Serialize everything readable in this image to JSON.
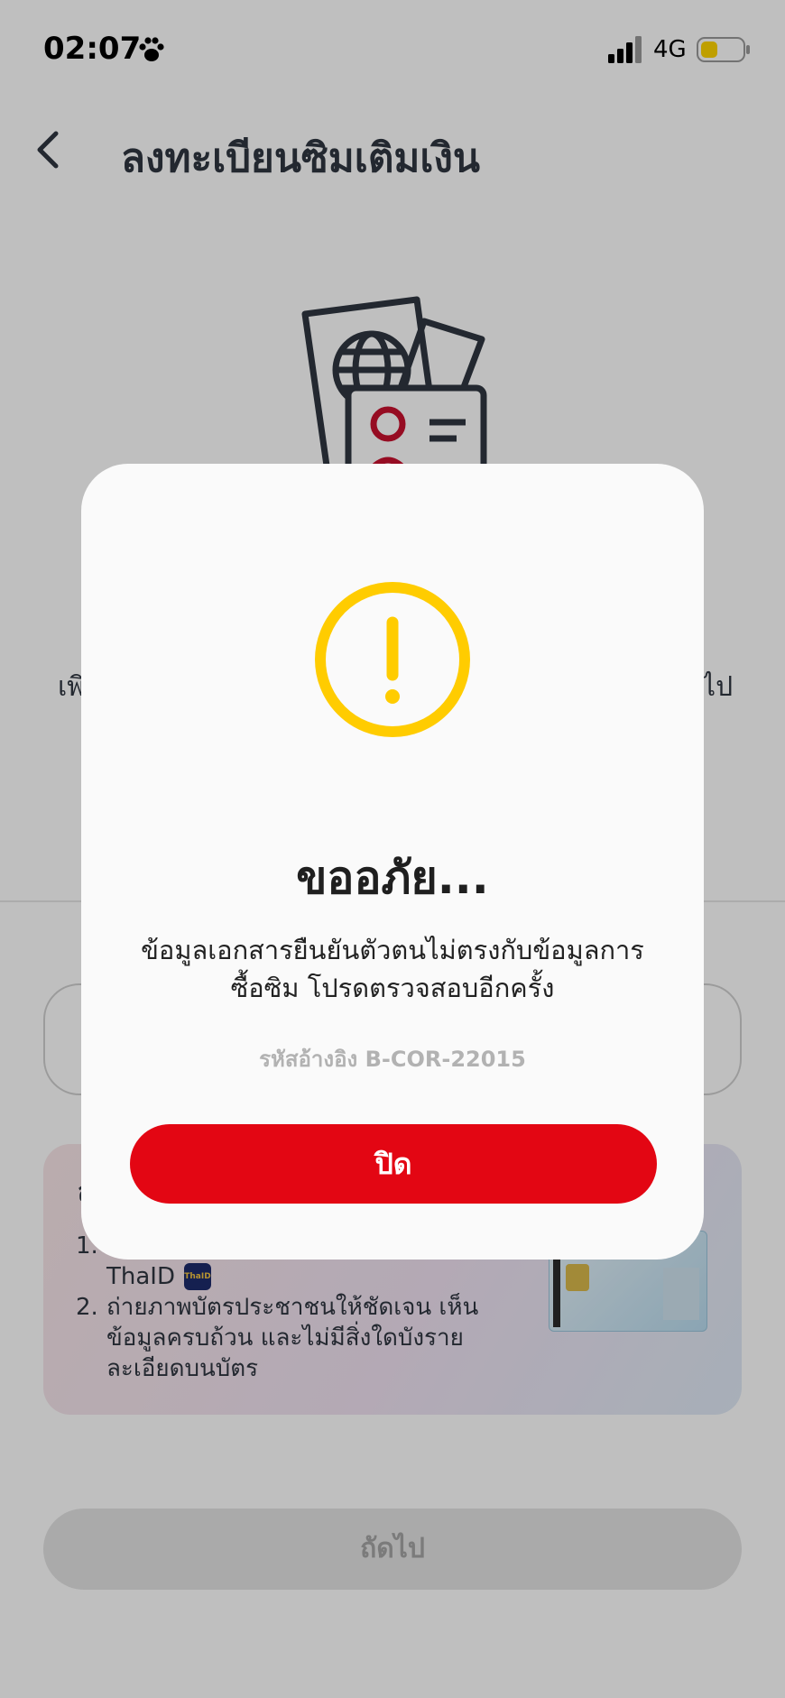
{
  "status_bar": {
    "time": "02:07",
    "network": "4G",
    "paw_icon": "paw-icon",
    "signal_icon": "signal-icon",
    "battery_icon": "battery-icon",
    "battery_color": "#ffd400"
  },
  "header": {
    "title": "ลงทะเบียนซิมเติมเงิน",
    "back_icon": "chevron-left-icon"
  },
  "background": {
    "text_left": "เพิ",
    "text_right": "ไป",
    "info_card": {
      "heading": "ส",
      "items": [
        {
          "number": "1.",
          "text": "ThaID",
          "badge": "ThaID"
        },
        {
          "number": "2.",
          "text": "ถ่ายภาพบัตรประชาชนให้ชัดเจน เห็นข้อมูลครบถ้วน และไม่มีสิ่งใดบังรายละเอียดบนบัตร"
        }
      ]
    },
    "next_button_label": "ถัดไป"
  },
  "modal": {
    "icon": "warning-icon",
    "icon_color": "#ffcc00",
    "title": "ขออภัย...",
    "message": "ข้อมูลเอกสารยืนยันตัวตนไม่ตรงกับข้อมูลการซื้อซิม โปรดตรวจสอบอีกครั้ง",
    "reference": "รหัสอ้างอิง B-COR-22015",
    "close_label": "ปิด",
    "close_color": "#e30613"
  }
}
